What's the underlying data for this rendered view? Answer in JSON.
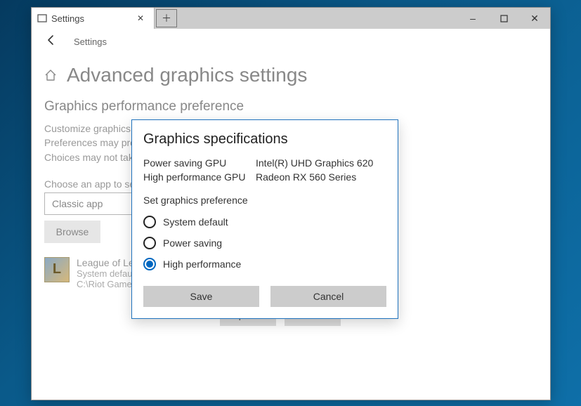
{
  "window": {
    "tab_label": "Settings",
    "controls": {
      "min": "–",
      "max": "▢",
      "close": "✕"
    }
  },
  "nav": {
    "breadcrumb": "Settings"
  },
  "page": {
    "title": "Advanced graphics settings",
    "section": "Graphics performance preference",
    "description": "Customize graphics performance preference for specific applications. Preferences may provide better app performance or save battery life. Choices may not take effect until the next time the app launches.",
    "choose_label": "Choose an app to set preference",
    "app_selector_value": "Classic app",
    "browse_button": "Browse",
    "app": {
      "name": "League of Legends",
      "pref": "System default",
      "path": "C:\\Riot Games\\League of Legends\\..."
    },
    "options_button": "Options",
    "remove_button": "Remove"
  },
  "dialog": {
    "title": "Graphics specifications",
    "power_saving_label": "Power saving GPU",
    "power_saving_value": "Intel(R) UHD Graphics 620",
    "high_perf_label": "High performance GPU",
    "high_perf_value": "Radeon RX 560 Series",
    "set_pref_label": "Set graphics preference",
    "options": [
      {
        "label": "System default",
        "selected": false
      },
      {
        "label": "Power saving",
        "selected": false
      },
      {
        "label": "High performance",
        "selected": true
      }
    ],
    "save": "Save",
    "cancel": "Cancel"
  }
}
